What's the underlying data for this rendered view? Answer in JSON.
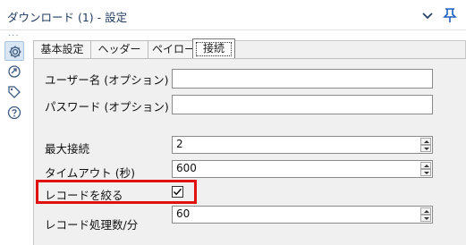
{
  "window": {
    "title": "ダウンロード (1) - 設定"
  },
  "sidebar": {
    "icons": [
      "settings-icon",
      "connection-icon",
      "tag-icon",
      "help-icon"
    ]
  },
  "tabs": [
    {
      "label": "基本設定",
      "active": false
    },
    {
      "label": "ヘッダー",
      "active": false
    },
    {
      "label": "ペイロード",
      "active": false
    },
    {
      "label": "接続",
      "active": true
    }
  ],
  "form": {
    "username_label": "ユーザー名 (オプション)",
    "username_value": "",
    "password_label": "パスワード (オプション)",
    "password_value": "",
    "max_connections_label": "最大接続",
    "max_connections_value": "2",
    "timeout_label": "タイムアウト (秒)",
    "timeout_value": "600",
    "throttle_label": "レコードを絞る",
    "throttle_checked": true,
    "records_per_min_label": "レコード処理数/分",
    "records_per_min_value": "60"
  },
  "colors": {
    "highlight": "#e0120f",
    "title_text": "#1f3a5f",
    "accent": "#1f5fbf"
  }
}
